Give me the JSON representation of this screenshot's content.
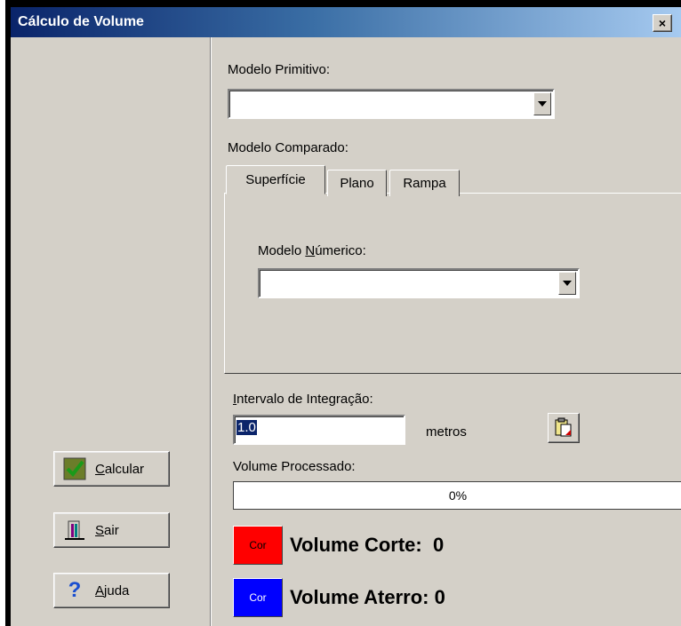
{
  "window": {
    "title": "Cálculo de Volume",
    "close_label": "×"
  },
  "buttons": {
    "calcular": {
      "label": "Calcular",
      "accel": "C",
      "rest": "alcular",
      "icon": "check-icon"
    },
    "sair": {
      "label": "Sair",
      "accel": "S",
      "rest": "air",
      "icon": "exit-door-icon"
    },
    "ajuda": {
      "label": "Ajuda",
      "accel": "A",
      "rest": "juda",
      "icon": "question-icon"
    }
  },
  "form": {
    "modelo_primitivo_label": "Modelo Primitivo:",
    "modelo_primitivo_value": "",
    "modelo_comparado_label": "Modelo Comparado:",
    "tabs": [
      {
        "label": "Superfície",
        "active": true
      },
      {
        "label": "Plano",
        "active": false
      },
      {
        "label": "Rampa",
        "active": false
      }
    ],
    "modelo_numerico_label": {
      "before": "Modelo ",
      "accel": "N",
      "after": "úmerico:"
    },
    "modelo_numerico_value": "",
    "intervalo_label": {
      "accel": "I",
      "after": "ntervalo de Integração:"
    },
    "intervalo_value": "1.0",
    "intervalo_unit": "metros",
    "volume_processado_label": "Volume Processado:",
    "progress_text": "0%",
    "progress_value": 0
  },
  "results": {
    "corte": {
      "button_label": "Cor",
      "color": "#ff0000",
      "label": "Volume Corte:",
      "value": "0"
    },
    "aterro": {
      "button_label": "Cor",
      "color": "#0000ff",
      "label": "Volume Aterro:",
      "value": "0"
    }
  }
}
